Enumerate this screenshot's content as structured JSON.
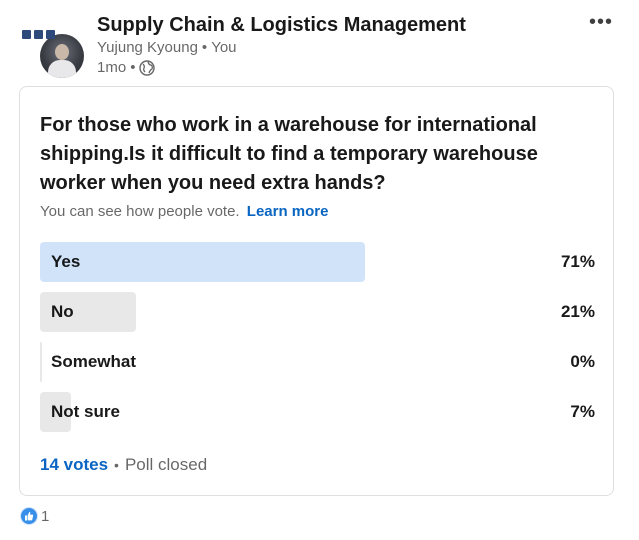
{
  "header": {
    "group_name": "Supply Chain & Logistics Management",
    "author": "Yujung Kyoung",
    "relation": "You",
    "time": "1mo",
    "more_icon": "ellipsis-icon",
    "visibility_icon": "globe-icon"
  },
  "poll": {
    "question": "For those who work in a warehouse for international shipping.Is it difficult to find a temporary warehouse worker when you need extra hands?",
    "visibility_note": "You can see how people vote.",
    "learn_more": "Learn more",
    "options": [
      {
        "label": "Yes",
        "percent_text": "71%",
        "percent": 71,
        "winner": true
      },
      {
        "label": "No",
        "percent_text": "21%",
        "percent": 21,
        "winner": false
      },
      {
        "label": "Somewhat",
        "percent_text": "0%",
        "percent": 0,
        "winner": false
      },
      {
        "label": "Not sure",
        "percent_text": "7%",
        "percent": 7,
        "winner": false
      }
    ],
    "votes": "14 votes",
    "status": "Poll closed"
  },
  "reactions": {
    "icon": "like-icon",
    "count": "1"
  },
  "colors": {
    "accent": "#0a66c2",
    "winner_bar": "#d0e3f9",
    "other_bar": "#e8e8e8"
  }
}
